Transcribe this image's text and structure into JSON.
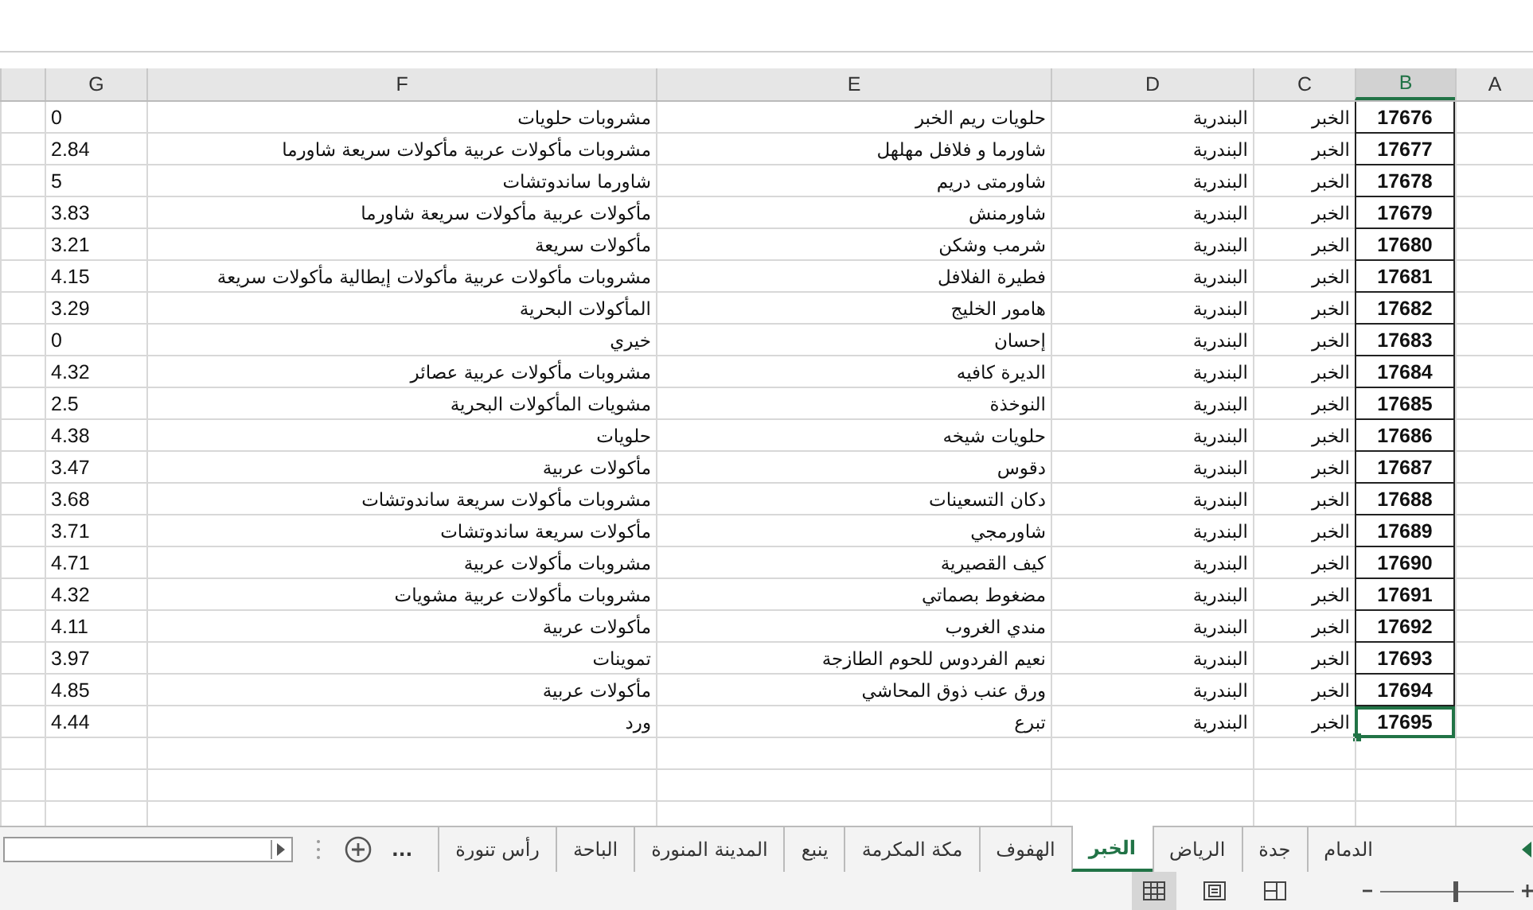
{
  "columns": [
    {
      "label": "A",
      "selected": false
    },
    {
      "label": "B",
      "selected": true
    },
    {
      "label": "C",
      "selected": false
    },
    {
      "label": "D",
      "selected": false
    },
    {
      "label": "E",
      "selected": false
    },
    {
      "label": "F",
      "selected": false
    },
    {
      "label": "G",
      "selected": false
    }
  ],
  "rows": [
    {
      "g": "0",
      "f": "مشروبات حلويات",
      "e": "حلويات ريم الخبر",
      "d": "البندرية",
      "c": "الخبر",
      "b": "17676",
      "selected": false
    },
    {
      "g": "2.84",
      "f": "مشروبات مأكولات عربية مأكولات سريعة شاورما",
      "e": "شاورما و فلافل مهلهل",
      "d": "البندرية",
      "c": "الخبر",
      "b": "17677",
      "selected": false
    },
    {
      "g": "5",
      "f": "شاورما ساندوتشات",
      "e": "شاورمتى دريم",
      "d": "البندرية",
      "c": "الخبر",
      "b": "17678",
      "selected": false
    },
    {
      "g": "3.83",
      "f": "مأكولات عربية مأكولات سريعة شاورما",
      "e": "شاورمنش",
      "d": "البندرية",
      "c": "الخبر",
      "b": "17679",
      "selected": false
    },
    {
      "g": "3.21",
      "f": "مأكولات سريعة",
      "e": "شرمب وشكن",
      "d": "البندرية",
      "c": "الخبر",
      "b": "17680",
      "selected": false
    },
    {
      "g": "4.15",
      "f": "مشروبات مأكولات عربية مأكولات إيطالية مأكولات سريعة",
      "e": "فطيرة الفلافل",
      "d": "البندرية",
      "c": "الخبر",
      "b": "17681",
      "selected": false
    },
    {
      "g": "3.29",
      "f": "المأكولات البحرية",
      "e": "هامور الخليج",
      "d": "البندرية",
      "c": "الخبر",
      "b": "17682",
      "selected": false
    },
    {
      "g": "0",
      "f": "خيري",
      "e": "إحسان",
      "d": "البندرية",
      "c": "الخبر",
      "b": "17683",
      "selected": false
    },
    {
      "g": "4.32",
      "f": "مشروبات مأكولات عربية عصائر",
      "e": "الديرة كافيه",
      "d": "البندرية",
      "c": "الخبر",
      "b": "17684",
      "selected": false
    },
    {
      "g": "2.5",
      "f": "مشويات المأكولات البحرية",
      "e": "النوخذة",
      "d": "البندرية",
      "c": "الخبر",
      "b": "17685",
      "selected": false
    },
    {
      "g": "4.38",
      "f": "حلويات",
      "e": "حلويات شيخه",
      "d": "البندرية",
      "c": "الخبر",
      "b": "17686",
      "selected": false
    },
    {
      "g": "3.47",
      "f": "مأكولات عربية",
      "e": "دقوس",
      "d": "البندرية",
      "c": "الخبر",
      "b": "17687",
      "selected": false
    },
    {
      "g": "3.68",
      "f": "مشروبات مأكولات سريعة ساندوتشات",
      "e": "دكان التسعينات",
      "d": "البندرية",
      "c": "الخبر",
      "b": "17688",
      "selected": false
    },
    {
      "g": "3.71",
      "f": "مأكولات سريعة ساندوتشات",
      "e": "شاورمجي",
      "d": "البندرية",
      "c": "الخبر",
      "b": "17689",
      "selected": false
    },
    {
      "g": "4.71",
      "f": "مشروبات مأكولات عربية",
      "e": "كيف القصيرية",
      "d": "البندرية",
      "c": "الخبر",
      "b": "17690",
      "selected": false
    },
    {
      "g": "4.32",
      "f": "مشروبات مأكولات عربية مشويات",
      "e": "مضغوط بصماتي",
      "d": "البندرية",
      "c": "الخبر",
      "b": "17691",
      "selected": false
    },
    {
      "g": "4.11",
      "f": "مأكولات عربية",
      "e": "مندي الغروب",
      "d": "البندرية",
      "c": "الخبر",
      "b": "17692",
      "selected": false
    },
    {
      "g": "3.97",
      "f": "تموينات",
      "e": "نعيم الفردوس للحوم الطازجة",
      "d": "البندرية",
      "c": "الخبر",
      "b": "17693",
      "selected": false
    },
    {
      "g": "4.85",
      "f": "مأكولات عربية",
      "e": "ورق عنب ذوق المحاشي",
      "d": "البندرية",
      "c": "الخبر",
      "b": "17694",
      "selected": false
    },
    {
      "g": "4.44",
      "f": "ورد",
      "e": "تبرع",
      "d": "البندرية",
      "c": "الخبر",
      "b": "17695",
      "selected": true
    }
  ],
  "sheet_tabs": [
    {
      "label": "الدمام",
      "selected": false
    },
    {
      "label": "جدة",
      "selected": false
    },
    {
      "label": "الرياض",
      "selected": false
    },
    {
      "label": "الخبر",
      "selected": true
    },
    {
      "label": "الهفوف",
      "selected": false
    },
    {
      "label": "مكة المكرمة",
      "selected": false
    },
    {
      "label": "ينبع",
      "selected": false
    },
    {
      "label": "المدينة المنورة",
      "selected": false
    },
    {
      "label": "الباحة",
      "selected": false
    },
    {
      "label": "رأس تنورة",
      "selected": false
    }
  ],
  "more_tabs": "...",
  "status_bar": {
    "views": [
      {
        "kind": "normal",
        "selected": true
      },
      {
        "kind": "page_layout",
        "selected": false
      },
      {
        "kind": "page_break",
        "selected": false
      }
    ],
    "zoom": {
      "level": 0.55
    }
  }
}
